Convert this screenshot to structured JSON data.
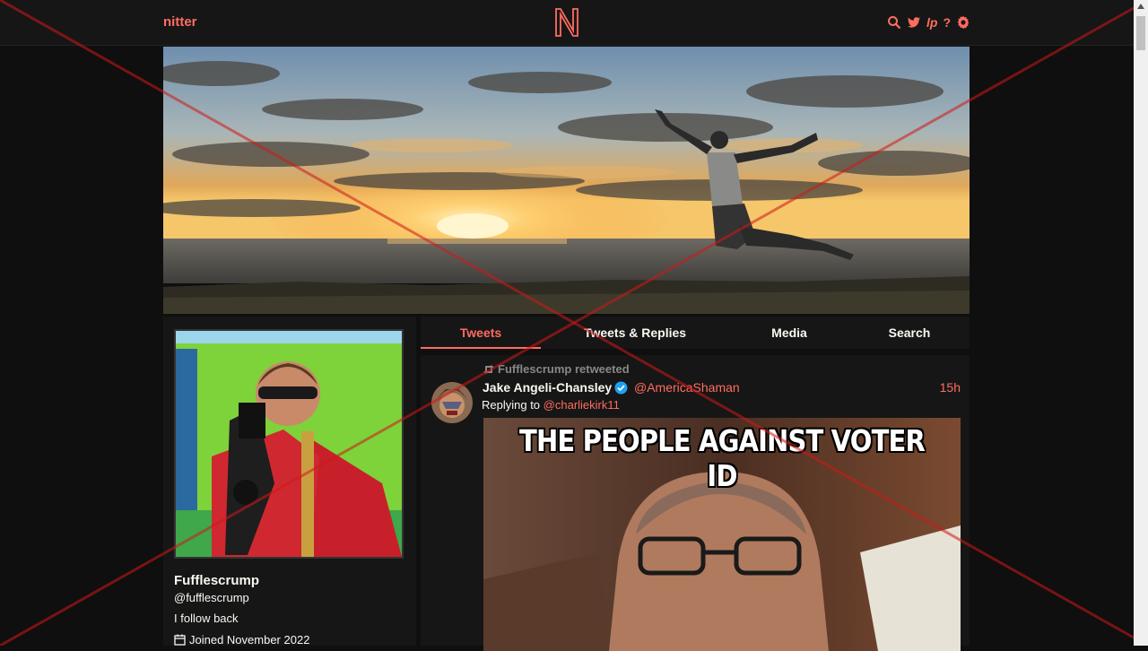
{
  "nav": {
    "brand": "nitter",
    "logo_letter": "N"
  },
  "nav_icons": [
    "search-icon",
    "twitter-bird-icon",
    "lp-icon",
    "help-icon",
    "gear-icon"
  ],
  "nav_lp_text": "lp",
  "nav_help_text": "?",
  "colors": {
    "accent": "#ff6c60",
    "background": "#0f0f0f",
    "panel": "#161616",
    "verified": "#1da1f2"
  },
  "profile": {
    "fullname": "Fufflescrump",
    "username": "@fufflescrump",
    "bio": "I follow back",
    "joined": "Joined November 2022"
  },
  "tabs": [
    "Tweets",
    "Tweets & Replies",
    "Media",
    "Search"
  ],
  "active_tab": "Tweets",
  "tweet": {
    "retweet_header": "Fufflescrump retweeted",
    "fullname": "Jake Angeli-Chansley",
    "username": "@AmericaShaman",
    "date": "15h",
    "replying_prefix": "Replying to",
    "replying_to": "@charliekirk11",
    "media_caption": "THE PEOPLE AGAINST VOTER ID"
  }
}
